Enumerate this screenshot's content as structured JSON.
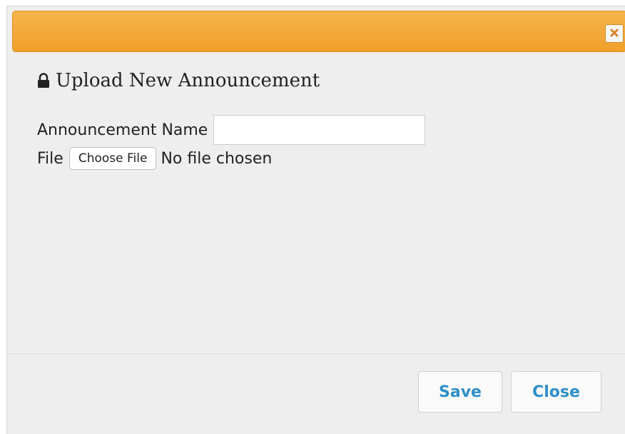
{
  "dialog": {
    "close_icon": "close-x-icon",
    "heading_icon": "lock-icon",
    "title": "Upload New Announcement",
    "accent_color": "#f0a02a"
  },
  "form": {
    "name_label": "Announcement Name",
    "name_value": "",
    "file_label": "File",
    "file_button_label": "Choose File",
    "file_status": "No file chosen"
  },
  "footer": {
    "save_label": "Save",
    "close_label": "Close",
    "button_text_color": "#2e8fc9"
  }
}
